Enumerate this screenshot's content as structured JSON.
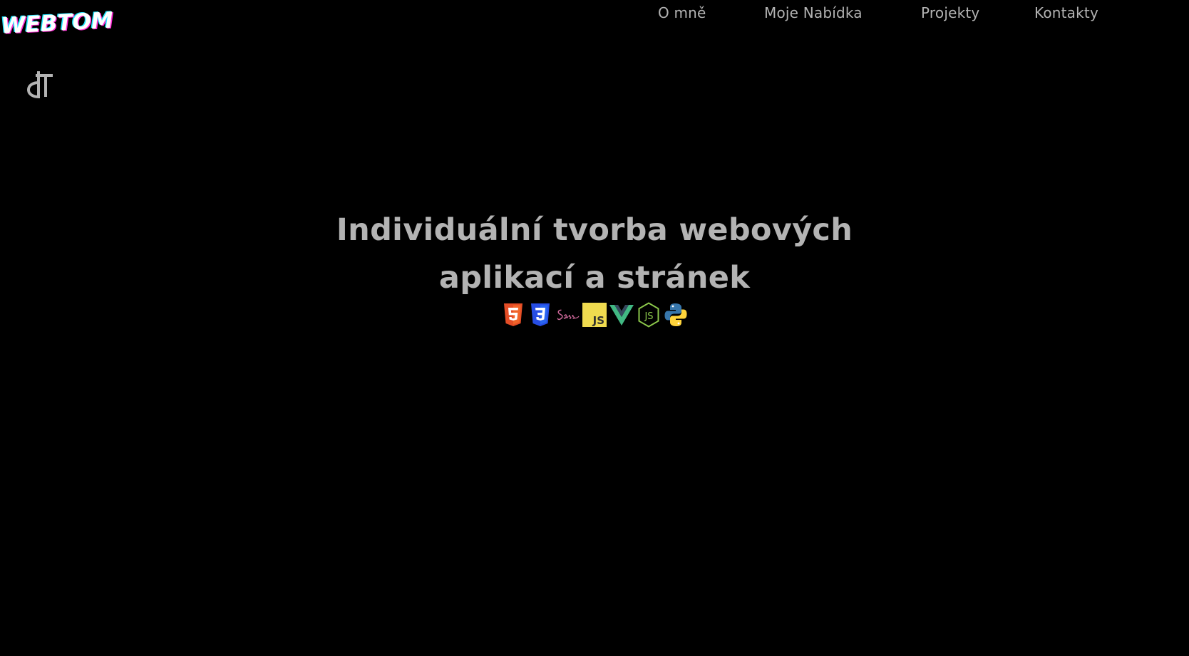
{
  "brand": {
    "logo_text": "WEBTOM",
    "monogram_text": "ŧT"
  },
  "nav": {
    "items": [
      {
        "label": "O mně"
      },
      {
        "label": "Moje Nabídka"
      },
      {
        "label": "Projekty"
      },
      {
        "label": "Kontakty"
      }
    ]
  },
  "hero": {
    "title_line1": "Individuální tvorba webových",
    "title_line2": "aplikací a stránek"
  },
  "tech_icons": [
    "html5-icon",
    "css3-icon",
    "sass-icon",
    "javascript-icon",
    "vue-icon",
    "nodejs-icon",
    "python-icon"
  ],
  "colors": {
    "background": "#000000",
    "text": "#b3b3b3",
    "html5": "#e44d26",
    "css3": "#264de4",
    "sass": "#cd6799",
    "javascript": "#f0db4f",
    "vue": "#41b883",
    "nodejs": "#8cc84b",
    "python_blue": "#3776ab",
    "python_yellow": "#ffd43b"
  }
}
